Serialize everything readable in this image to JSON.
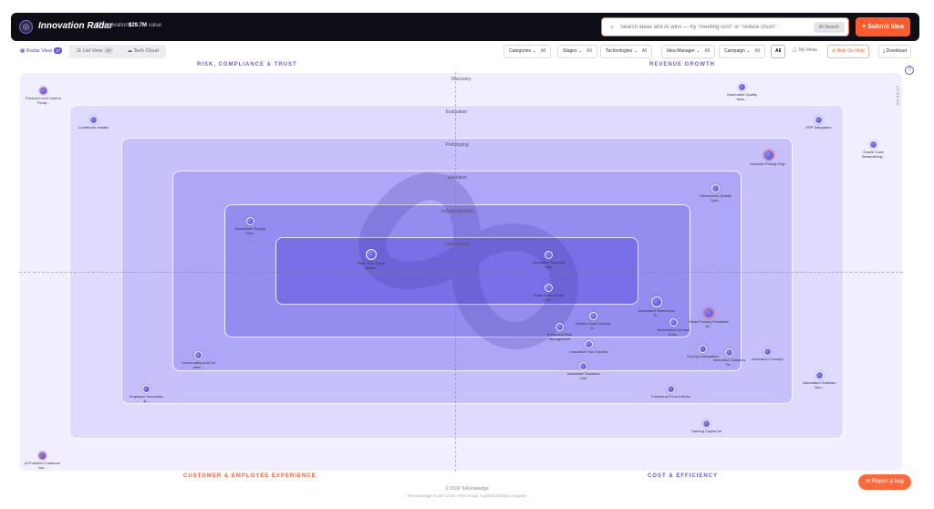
{
  "header": {
    "logo_icon": "radar-logo-icon",
    "title": "Innovation Radar",
    "innovations_count": "27",
    "innovations_label": "innovations",
    "value_amount": "$29.7M",
    "value_label": "value",
    "search_placeholder": "Search ideas and AI wins — try \"meeting cost\" or \"reduce churn\"",
    "ai_search_label": "AI Search",
    "submit_label": "Submit Idea"
  },
  "toolbar": {
    "views": [
      {
        "label": "Radar View",
        "count": "27",
        "active": true
      },
      {
        "label": "List View",
        "count": "27",
        "active": false
      },
      {
        "label": "Tech Cloud",
        "count": "",
        "active": false
      }
    ],
    "filters": [
      {
        "label": "Categories",
        "value": "All"
      },
      {
        "label": "Stages",
        "value": "All"
      },
      {
        "label": "Technologies",
        "value": "All"
      },
      {
        "label": "Idea Manager",
        "value": "All"
      },
      {
        "label": "Campaign",
        "value": "All"
      }
    ],
    "all_toggle": "All",
    "my_ideas": "My Ideas",
    "hide_on_hold": "Hide On Hold",
    "download": "Download"
  },
  "quadrants": {
    "top_left": "RISK, COMPLIANCE & TRUST",
    "top_right": "REVENUE GROWTH",
    "bottom_left": "CUSTOMER & EMPLOYEE EXPERIENCE",
    "bottom_right": "COST & EFFICIENCY"
  },
  "rings": [
    "Discovery",
    "Evaluation",
    "Prototyping",
    "Validation",
    "Industrialization",
    "Optimization"
  ],
  "ideas": [
    {
      "label": "Product-Level Carbon Footp..."
    },
    {
      "label": "Contributor Inmatic"
    },
    {
      "label": "Automated Quality Assu..."
    },
    {
      "label": "ERP Integration"
    },
    {
      "label": "Dynamic Pricing Engi..."
    },
    {
      "label": "Oracle Code Streamlining..."
    },
    {
      "label": "Streamlined Quality Syst..."
    },
    {
      "label": "Blockchain Supply Chai..."
    },
    {
      "label": "Real-Time Fraud Detect..."
    },
    {
      "label": "Innovation Business Hub"
    },
    {
      "label": "Smart Data Center Con..."
    },
    {
      "label": "Automated Warehouse R..."
    },
    {
      "label": "Smart Factory Predictive M..."
    },
    {
      "label": "Modern Deal Capture S..."
    },
    {
      "label": "Automated Contract Com..."
    },
    {
      "label": "Enhanced Risk Management"
    },
    {
      "label": "Innovative Tool Solution"
    },
    {
      "label": "Innovative Solutions Hub"
    },
    {
      "label": "Conversational AI for Inter..."
    },
    {
      "label": "DevOps Integration"
    },
    {
      "label": "Innovative Solutions Te..."
    },
    {
      "label": "Innovation Concept"
    },
    {
      "label": "Employee Innovation B..."
    },
    {
      "label": "Functional Form Entries"
    },
    {
      "label": "Automated Software Dev..."
    },
    {
      "label": "Training Capital for"
    },
    {
      "label": "AI-Powered Customer Jou..."
    }
  ],
  "legend_label": "LEGEND",
  "footer": {
    "copyright": "© 2026 TeKnowledge",
    "tagline": "TeKnowledge is part of the FNH Group, a global holding company"
  },
  "report_bug_label": "Report a bug",
  "colors": {
    "accent": "#5d55e0",
    "brand_orange": "#ff5a2c"
  }
}
